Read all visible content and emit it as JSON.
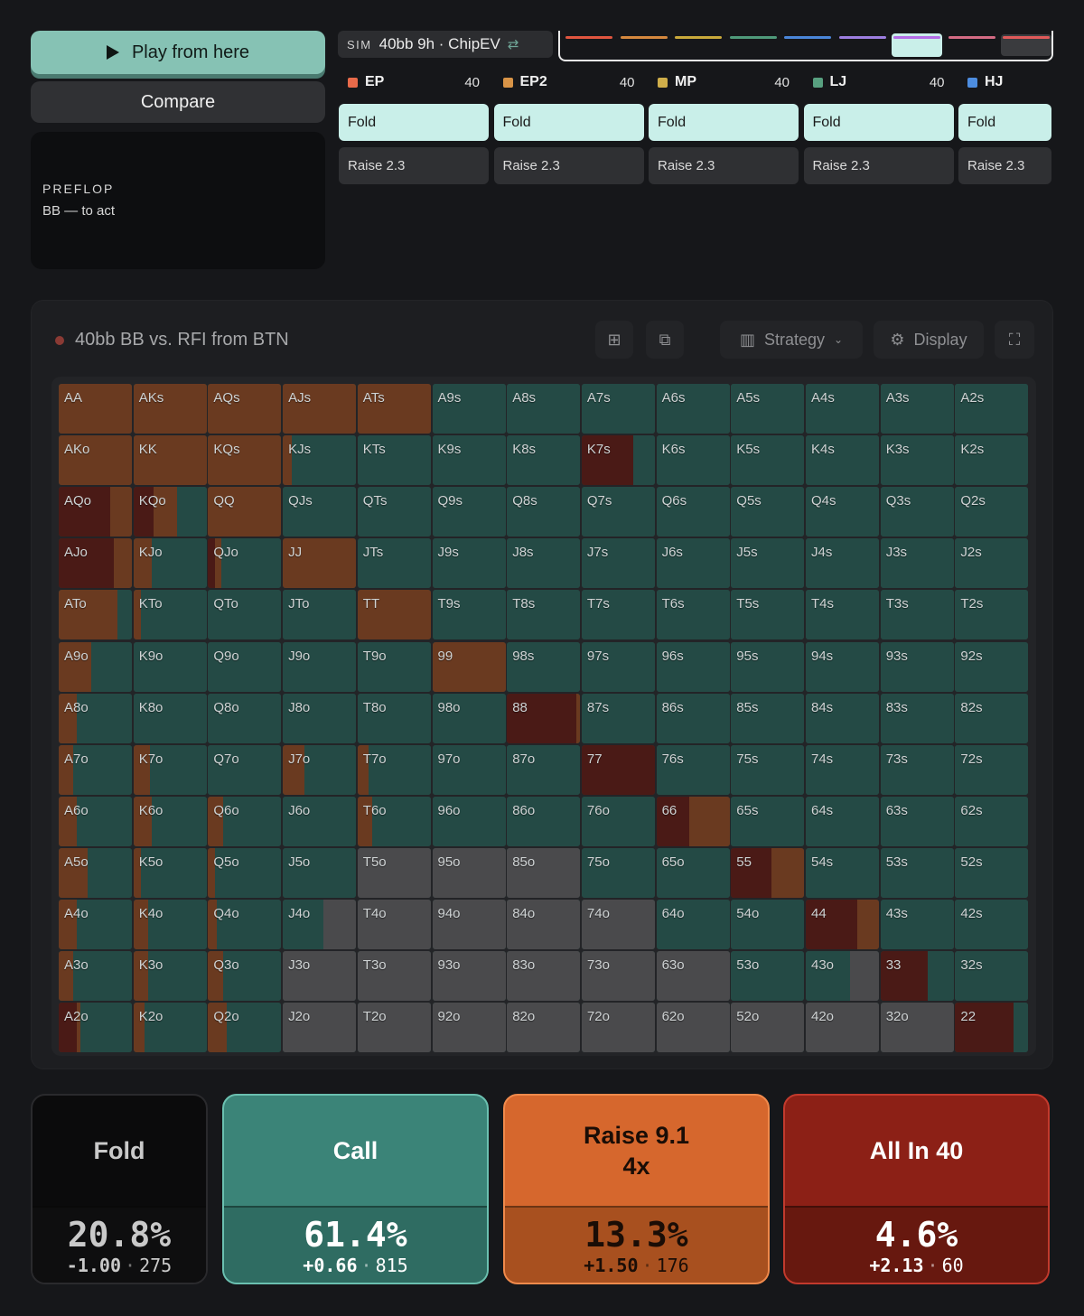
{
  "controls": {
    "play_label": "Play from here",
    "compare_label": "Compare",
    "street": "PREFLOP",
    "actor": "BB — to act"
  },
  "sim": {
    "tag": "SIM",
    "name": "40bb 9h · ChipEV",
    "swap_icon": "swap-icon",
    "timeline_colors": [
      "#e0553f",
      "#d5883e",
      "#c9a93b",
      "#4f9a7a",
      "#4a86d9",
      "#9d7ee0",
      "#b36ee6",
      "#d46b84",
      "#e05a5a"
    ]
  },
  "positions": [
    {
      "name": "EP",
      "stack": "40",
      "color": "#e86a4a",
      "fold": "Fold",
      "raise": "Raise 2.3"
    },
    {
      "name": "EP2",
      "stack": "40",
      "color": "#d89447",
      "fold": "Fold",
      "raise": "Raise 2.3"
    },
    {
      "name": "MP",
      "stack": "40",
      "color": "#cfae4a",
      "fold": "Fold",
      "raise": "Raise 2.3"
    },
    {
      "name": "LJ",
      "stack": "40",
      "color": "#58a080",
      "fold": "Fold",
      "raise": "Raise 2.3"
    },
    {
      "name": "HJ",
      "stack": "",
      "color": "#4d8de0",
      "fold": "Fold",
      "raise": "Raise 2.3"
    }
  ],
  "panel": {
    "title": "40bb BB vs. RFI from BTN",
    "strategy_label": "Strategy",
    "display_label": "Display"
  },
  "colors": {
    "fold": "#4a4a4c",
    "call": "#244a45",
    "raise": "#6a3a20",
    "allin": "#4a1a16"
  },
  "grid": [
    [
      "AA",
      "AKs",
      "AQs",
      "AJs",
      "ATs",
      "A9s",
      "A8s",
      "A7s",
      "A6s",
      "A5s",
      "A4s",
      "A3s",
      "A2s"
    ],
    [
      "AKo",
      "KK",
      "KQs",
      "KJs",
      "KTs",
      "K9s",
      "K8s",
      "K7s",
      "K6s",
      "K5s",
      "K4s",
      "K3s",
      "K2s"
    ],
    [
      "AQo",
      "KQo",
      "QQ",
      "QJs",
      "QTs",
      "Q9s",
      "Q8s",
      "Q7s",
      "Q6s",
      "Q5s",
      "Q4s",
      "Q3s",
      "Q2s"
    ],
    [
      "AJo",
      "KJo",
      "QJo",
      "JJ",
      "JTs",
      "J9s",
      "J8s",
      "J7s",
      "J6s",
      "J5s",
      "J4s",
      "J3s",
      "J2s"
    ],
    [
      "ATo",
      "KTo",
      "QTo",
      "JTo",
      "TT",
      "T9s",
      "T8s",
      "T7s",
      "T6s",
      "T5s",
      "T4s",
      "T3s",
      "T2s"
    ],
    [
      "A9o",
      "K9o",
      "Q9o",
      "J9o",
      "T9o",
      "99",
      "98s",
      "97s",
      "96s",
      "95s",
      "94s",
      "93s",
      "92s"
    ],
    [
      "A8o",
      "K8o",
      "Q8o",
      "J8o",
      "T8o",
      "98o",
      "88",
      "87s",
      "86s",
      "85s",
      "84s",
      "83s",
      "82s"
    ],
    [
      "A7o",
      "K7o",
      "Q7o",
      "J7o",
      "T7o",
      "97o",
      "87o",
      "77",
      "76s",
      "75s",
      "74s",
      "73s",
      "72s"
    ],
    [
      "A6o",
      "K6o",
      "Q6o",
      "J6o",
      "T6o",
      "96o",
      "86o",
      "76o",
      "66",
      "65s",
      "64s",
      "63s",
      "62s"
    ],
    [
      "A5o",
      "K5o",
      "Q5o",
      "J5o",
      "T5o",
      "95o",
      "85o",
      "75o",
      "65o",
      "55",
      "54s",
      "53s",
      "52s"
    ],
    [
      "A4o",
      "K4o",
      "Q4o",
      "J4o",
      "T4o",
      "94o",
      "84o",
      "74o",
      "64o",
      "54o",
      "44",
      "43s",
      "42s"
    ],
    [
      "A3o",
      "K3o",
      "Q3o",
      "J3o",
      "T3o",
      "93o",
      "83o",
      "73o",
      "63o",
      "53o",
      "43o",
      "33",
      "32s"
    ],
    [
      "A2o",
      "K2o",
      "Q2o",
      "J2o",
      "T2o",
      "92o",
      "82o",
      "72o",
      "62o",
      "52o",
      "42o",
      "32o",
      "22"
    ]
  ],
  "mix_overrides": {
    "AA": [
      0,
      0,
      1,
      0
    ],
    "AKs": [
      0,
      0,
      1,
      0
    ],
    "AQs": [
      0,
      0,
      1,
      0
    ],
    "AJs": [
      0,
      0,
      1,
      0
    ],
    "ATs": [
      0,
      0,
      1,
      0
    ],
    "AKo": [
      0,
      0,
      1,
      0
    ],
    "KK": [
      0,
      0,
      1,
      0
    ],
    "KQs": [
      0,
      0,
      1,
      0
    ],
    "QQ": [
      0,
      0,
      1,
      0
    ],
    "KJs": [
      0,
      0.88,
      0.12,
      0
    ],
    "K7s": [
      0,
      0.3,
      0,
      0.7
    ],
    "AQo": [
      0,
      0,
      0.3,
      0.7
    ],
    "KQo": [
      0,
      0.4,
      0.33,
      0.27
    ],
    "AJo": [
      0,
      0,
      0.25,
      0.75
    ],
    "KJo": [
      0,
      0.75,
      0.25,
      0
    ],
    "QJo": [
      0,
      0.82,
      0.09,
      0.09
    ],
    "JJ": [
      0,
      0,
      1,
      0
    ],
    "ATo": [
      0,
      0.2,
      0.8,
      0
    ],
    "KTo": [
      0,
      0.9,
      0.1,
      0
    ],
    "TT": [
      0,
      0,
      1,
      0
    ],
    "A9o": [
      0,
      0.55,
      0.45,
      0
    ],
    "99": [
      0,
      0,
      1,
      0
    ],
    "A8o": [
      0,
      0.75,
      0.25,
      0
    ],
    "88": [
      0,
      0,
      0.05,
      0.95
    ],
    "A7o": [
      0,
      0.8,
      0.2,
      0
    ],
    "K7o": [
      0,
      0.78,
      0.22,
      0
    ],
    "J7o": [
      0,
      0.7,
      0.3,
      0
    ],
    "T7o": [
      0,
      0.85,
      0.15,
      0
    ],
    "77": [
      0,
      0,
      0,
      1
    ],
    "A6o": [
      0,
      0.75,
      0.25,
      0
    ],
    "K6o": [
      0,
      0.75,
      0.25,
      0
    ],
    "Q6o": [
      0,
      0.8,
      0.2,
      0
    ],
    "T6o": [
      0,
      0.8,
      0.2,
      0
    ],
    "66": [
      0,
      0,
      0.55,
      0.45
    ],
    "A5o": [
      0,
      0.6,
      0.4,
      0
    ],
    "K5o": [
      0,
      0.9,
      0.1,
      0
    ],
    "Q5o": [
      0,
      0.9,
      0.1,
      0
    ],
    "T5o": [
      1,
      0,
      0,
      0
    ],
    "95o": [
      1,
      0,
      0,
      0
    ],
    "85o": [
      1,
      0,
      0,
      0
    ],
    "55": [
      0,
      0,
      0.45,
      0.55
    ],
    "A4o": [
      0,
      0.75,
      0.25,
      0
    ],
    "K4o": [
      0,
      0.8,
      0.2,
      0
    ],
    "Q4o": [
      0,
      0.88,
      0.12,
      0
    ],
    "J4o": [
      0.45,
      0.55,
      0,
      0
    ],
    "T4o": [
      1,
      0,
      0,
      0
    ],
    "94o": [
      1,
      0,
      0,
      0
    ],
    "84o": [
      1,
      0,
      0,
      0
    ],
    "74o": [
      1,
      0,
      0,
      0
    ],
    "44": [
      0,
      0,
      0.3,
      0.7
    ],
    "A3o": [
      0,
      0.8,
      0.2,
      0
    ],
    "K3o": [
      0,
      0.8,
      0.2,
      0
    ],
    "Q3o": [
      0,
      0.8,
      0.2,
      0
    ],
    "J3o": [
      1,
      0,
      0,
      0
    ],
    "T3o": [
      1,
      0,
      0,
      0
    ],
    "93o": [
      1,
      0,
      0,
      0
    ],
    "83o": [
      1,
      0,
      0,
      0
    ],
    "73o": [
      1,
      0,
      0,
      0
    ],
    "63o": [
      1,
      0,
      0,
      0
    ],
    "43o": [
      0.4,
      0.6,
      0,
      0
    ],
    "33": [
      0,
      0.35,
      0,
      0.65
    ],
    "A2o": [
      0,
      0.7,
      0.05,
      0.25
    ],
    "K2o": [
      0,
      0.85,
      0.15,
      0
    ],
    "Q2o": [
      0,
      0.75,
      0.25,
      0
    ],
    "J2o": [
      1,
      0,
      0,
      0
    ],
    "T2o": [
      1,
      0,
      0,
      0
    ],
    "92o": [
      1,
      0,
      0,
      0
    ],
    "82o": [
      1,
      0,
      0,
      0
    ],
    "72o": [
      1,
      0,
      0,
      0
    ],
    "62o": [
      1,
      0,
      0,
      0
    ],
    "52o": [
      1,
      0,
      0,
      0
    ],
    "42o": [
      1,
      0,
      0,
      0
    ],
    "32o": [
      1,
      0,
      0,
      0
    ],
    "22": [
      0,
      0.2,
      0,
      0.8
    ]
  },
  "summary": [
    {
      "key": "fold",
      "label": "Fold",
      "pct": "20.8%",
      "ev": "-1.00",
      "count": "275",
      "bg": "#0b0b0c",
      "bot": "#0e0e0f",
      "border": "#2a2a2d",
      "fg": "#c9c9c9"
    },
    {
      "key": "call",
      "label": "Call",
      "pct": "61.4%",
      "ev": "+0.66",
      "count": "815",
      "bg": "#3b8478",
      "bot": "#2f6c62",
      "border": "#6bc0b0",
      "fg": "#ffffff"
    },
    {
      "key": "raise",
      "label": "Raise 9.1\n4x",
      "pct": "13.3%",
      "ev": "+1.50",
      "count": "176",
      "bg": "#d6672d",
      "bot": "#a8501f",
      "border": "#f08a4c",
      "fg": "#1a0d06"
    },
    {
      "key": "allin",
      "label": "All In 40",
      "pct": "4.6%",
      "ev": "+2.13",
      "count": "60",
      "bg": "#8c2016",
      "bot": "#67180f",
      "border": "#c23a2d",
      "fg": "#ffffff"
    }
  ]
}
